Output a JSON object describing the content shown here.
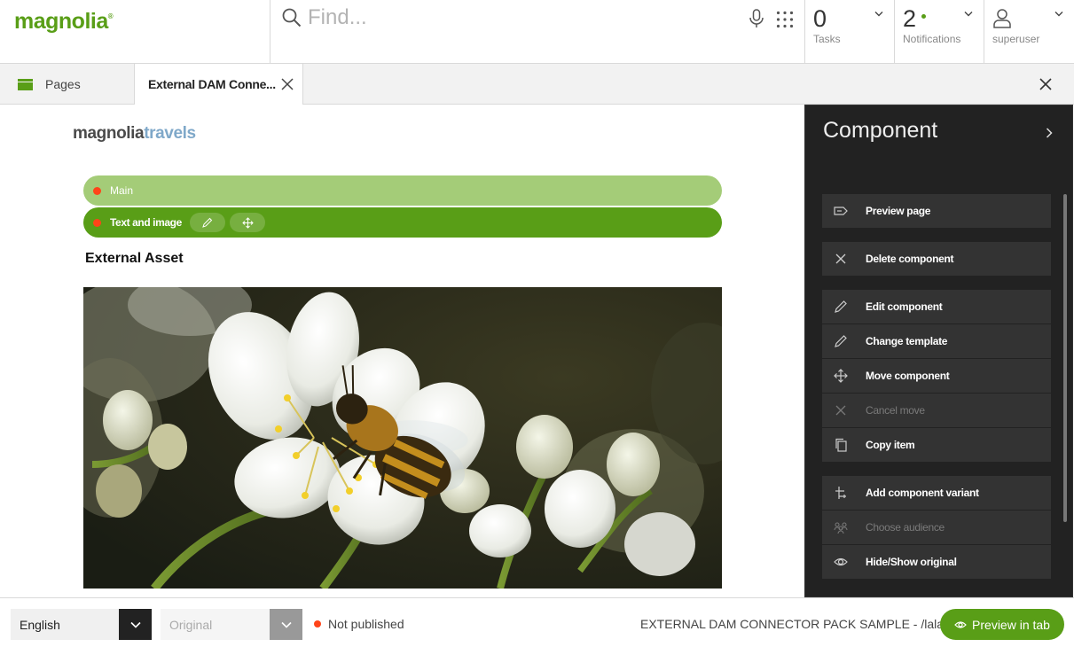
{
  "app": {
    "logo": "magnolia",
    "search_placeholder": "Find..."
  },
  "header": {
    "tasks": {
      "count": "0",
      "label": "Tasks"
    },
    "notifications": {
      "count": "2",
      "label": "Notifications"
    },
    "user": {
      "label": "superuser"
    }
  },
  "tabs": [
    {
      "label": "Pages",
      "active": false
    },
    {
      "label": "External DAM Conne...",
      "active": true
    }
  ],
  "page": {
    "site_logo_a": "magnolia",
    "site_logo_b": "travels",
    "areas": [
      {
        "label": "Main",
        "color": "#a4cc78"
      },
      {
        "label": "Text and image",
        "color": "#599e17"
      }
    ],
    "asset_title": "External Asset",
    "image": "bee on white cherry blossoms"
  },
  "panel": {
    "title": "Component",
    "actions": [
      {
        "label": "Preview page",
        "icon": "preview-icon",
        "enabled": true
      },
      {
        "label": "Delete component",
        "icon": "close-icon",
        "enabled": true
      },
      {
        "label": "Edit component",
        "icon": "pencil-icon",
        "enabled": true
      },
      {
        "label": "Change template",
        "icon": "pencil-icon",
        "enabled": true
      },
      {
        "label": "Move component",
        "icon": "move-icon",
        "enabled": true
      },
      {
        "label": "Cancel move",
        "icon": "close-icon",
        "enabled": false
      },
      {
        "label": "Copy item",
        "icon": "copy-icon",
        "enabled": true
      },
      {
        "label": "Add component variant",
        "icon": "variant-icon",
        "enabled": true
      },
      {
        "label": "Choose audience",
        "icon": "audience-icon",
        "enabled": false
      },
      {
        "label": "Hide/Show original",
        "icon": "eye-icon",
        "enabled": true
      }
    ]
  },
  "footer": {
    "language": "English",
    "version": "Original",
    "status": "Not published",
    "path": "EXTERNAL DAM CONNECTOR PACK SAMPLE - /lala",
    "preview_button": "Preview in tab"
  },
  "colors": {
    "brand_green": "#599e17",
    "light_green": "#a4cc78",
    "status_red": "#ff4419",
    "panel_bg": "#222222",
    "action_bg": "#333333"
  }
}
